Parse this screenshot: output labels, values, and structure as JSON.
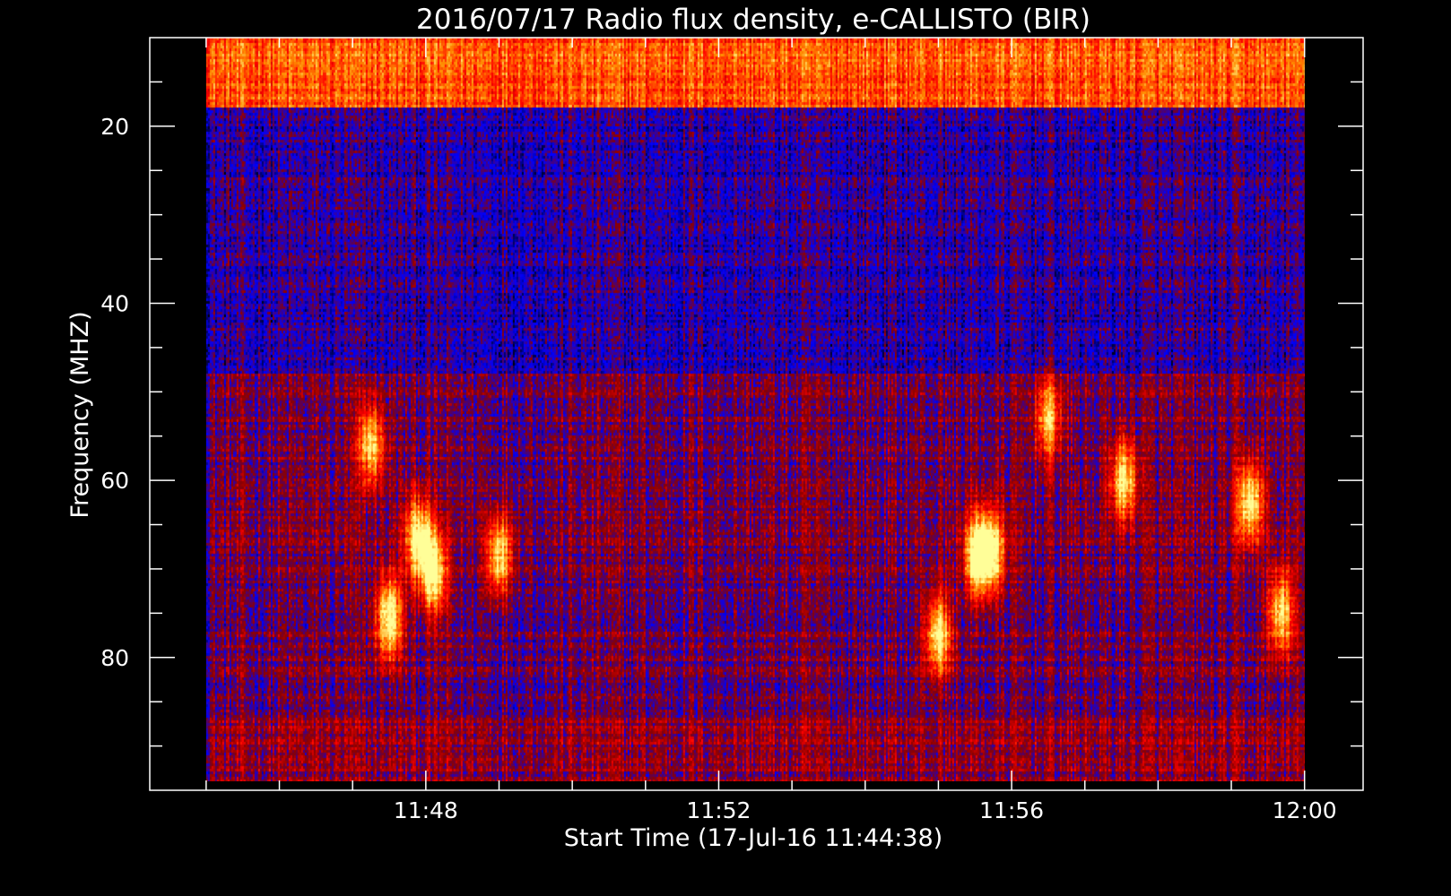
{
  "chart_data": {
    "type": "heatmap",
    "title": "2016/07/17  Radio flux density, e-CALLISTO (BIR)",
    "xlabel": "Start Time (17-Jul-16 11:44:38)",
    "ylabel": "Frequency (MHZ)",
    "x_axis": {
      "unit": "minutes after 11:44:38",
      "data_range": [
        0.37,
        15.37
      ],
      "axis_range": [
        -0.4,
        16.17
      ],
      "major_ticks": [
        {
          "value": 3.37,
          "label": "11:48"
        },
        {
          "value": 7.37,
          "label": "11:52"
        },
        {
          "value": 11.37,
          "label": "11:56"
        },
        {
          "value": 15.37,
          "label": "12:00"
        }
      ],
      "minor_tick_step": 1
    },
    "y_axis": {
      "inverted": true,
      "data_range": [
        10,
        94
      ],
      "axis_range": [
        10,
        95
      ],
      "major_ticks": [
        {
          "value": 20,
          "label": "20"
        },
        {
          "value": 40,
          "label": "40"
        },
        {
          "value": 60,
          "label": "60"
        },
        {
          "value": 80,
          "label": "80"
        }
      ],
      "minor_tick_step": 5
    },
    "colormap": [
      "#000000",
      "#0000ff",
      "#8b0000",
      "#ff0000",
      "#ff8c00",
      "#ffff99"
    ],
    "bands": [
      {
        "f0": 10,
        "f1": 18,
        "level": 0.72
      },
      {
        "f0": 18,
        "f1": 48,
        "level": 0.25
      },
      {
        "f0": 48,
        "f1": 87,
        "level": 0.35
      },
      {
        "f0": 87,
        "f1": 94,
        "level": 0.4
      }
    ],
    "bursts": [
      {
        "t": 2.87,
        "f": 75.5,
        "intensity": 1.0
      },
      {
        "t": 3.27,
        "f": 66.5,
        "intensity": 0.9
      },
      {
        "t": 3.47,
        "f": 70.5,
        "intensity": 0.95
      },
      {
        "t": 2.62,
        "f": 56.0,
        "intensity": 0.8
      },
      {
        "t": 4.37,
        "f": 68.5,
        "intensity": 0.85
      },
      {
        "t": 10.37,
        "f": 77.5,
        "intensity": 0.9
      },
      {
        "t": 10.9,
        "f": 68.5,
        "intensity": 1.0
      },
      {
        "t": 14.62,
        "f": 62.5,
        "intensity": 0.9
      },
      {
        "t": 12.9,
        "f": 60.0,
        "intensity": 0.85
      },
      {
        "t": 15.05,
        "f": 75.0,
        "intensity": 0.85
      },
      {
        "t": 11.87,
        "f": 53.0,
        "intensity": 0.75
      },
      {
        "t": 11.1,
        "f": 68.0,
        "intensity": 0.8
      }
    ]
  }
}
